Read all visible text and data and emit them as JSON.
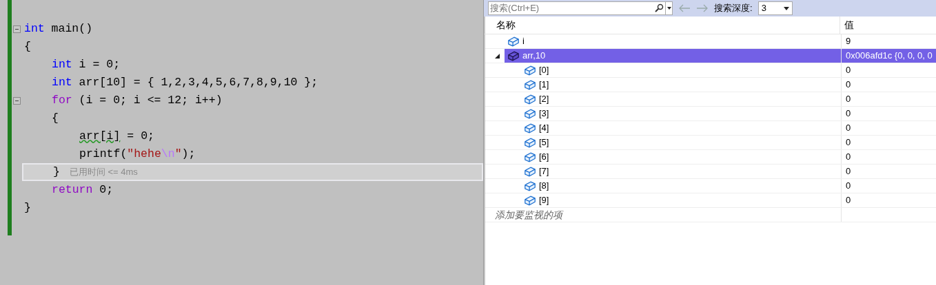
{
  "editor": {
    "lines": [
      {
        "fold": true,
        "tokens": [
          {
            "text": "int",
            "kind": "keyword"
          },
          {
            "text": " main()",
            "kind": "plain"
          }
        ]
      },
      {
        "tokens": [
          {
            "text": "{",
            "kind": "plain"
          }
        ],
        "children": [
          {
            "tokens": [
              {
                "text": "int",
                "kind": "keyword"
              },
              {
                "text": " i = 0;",
                "kind": "plain"
              }
            ]
          },
          {
            "tokens": [
              {
                "text": "int",
                "kind": "keyword"
              },
              {
                "text": " arr[10] = { 1,2,3,4,5,6,7,8,9,10 };",
                "kind": "plain"
              }
            ]
          },
          {
            "fold": true,
            "tokens": [
              {
                "text": "for",
                "kind": "control"
              },
              {
                "text": " (i = 0; i <= 12; i++)",
                "kind": "plain"
              }
            ]
          },
          {
            "tokens": [
              {
                "text": "{",
                "kind": "plain"
              }
            ],
            "children": [
              {
                "tokens": [
                  {
                    "text": "arr[i]",
                    "kind": "plain",
                    "squiggle": true
                  },
                  {
                    "text": " = 0;",
                    "kind": "plain"
                  }
                ]
              },
              {
                "tokens": [
                  {
                    "text": "printf(",
                    "kind": "plain"
                  },
                  {
                    "text": "\"hehe",
                    "kind": "string"
                  },
                  {
                    "text": "\\n",
                    "kind": "escape"
                  },
                  {
                    "text": "\"",
                    "kind": "string"
                  },
                  {
                    "text": ");",
                    "kind": "plain"
                  }
                ]
              }
            ]
          },
          {
            "current": true,
            "hint": "已用时间 <= 4ms",
            "tokens": [
              {
                "text": "}",
                "kind": "plain"
              }
            ]
          },
          {
            "tokens": [
              {
                "text": "return",
                "kind": "control"
              },
              {
                "text": " 0;",
                "kind": "plain"
              }
            ]
          }
        ]
      },
      {
        "tokens": [
          {
            "text": "}",
            "kind": "plain"
          }
        ]
      }
    ]
  },
  "watch": {
    "search": {
      "placeholder": "搜索(Ctrl+E)"
    },
    "depth_label": "搜索深度:",
    "depth": "3",
    "columns": [
      "名称",
      "值"
    ],
    "items": [
      {
        "name": "i",
        "value": "9",
        "selected": false
      },
      {
        "name": "arr,10",
        "value": "0x006afd1c {0, 0, 0, 0",
        "selected": true,
        "expanded": true,
        "children": [
          {
            "name": "[0]",
            "value": "0",
            "selected": false
          },
          {
            "name": "[1]",
            "value": "0",
            "selected": false
          },
          {
            "name": "[2]",
            "value": "0",
            "selected": false
          },
          {
            "name": "[3]",
            "value": "0",
            "selected": false
          },
          {
            "name": "[4]",
            "value": "0",
            "selected": false
          },
          {
            "name": "[5]",
            "value": "0",
            "selected": false
          },
          {
            "name": "[6]",
            "value": "0",
            "selected": false
          },
          {
            "name": "[7]",
            "value": "0",
            "selected": false
          },
          {
            "name": "[8]",
            "value": "0",
            "selected": false
          },
          {
            "name": "[9]",
            "value": "0",
            "selected": false
          }
        ]
      }
    ],
    "add_placeholder": "添加要监视的项"
  }
}
